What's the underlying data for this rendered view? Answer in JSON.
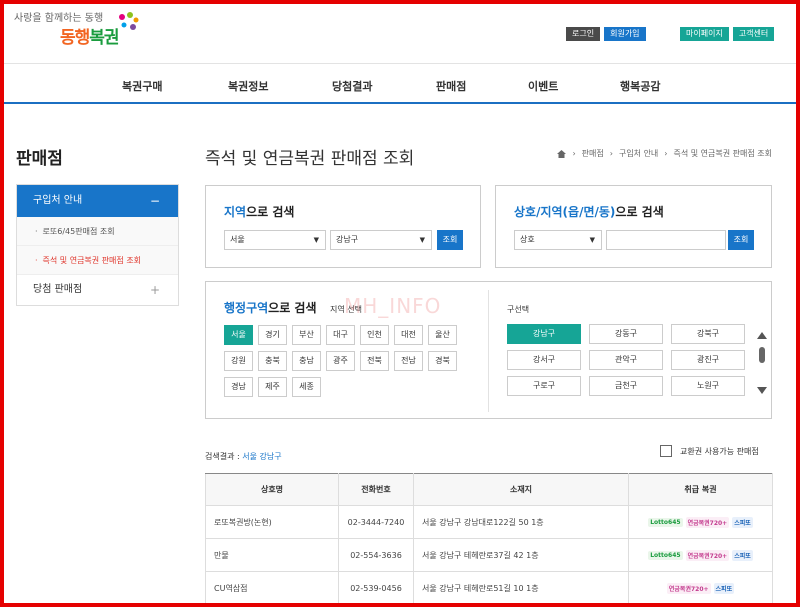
{
  "header": {
    "tagline": "사랑을 함께하는 동행",
    "brand_part1": "동행",
    "brand_part2": "복권",
    "util_left": [
      "로그인",
      "회원가입"
    ],
    "util_right": [
      "마이페이지",
      "고객센터"
    ]
  },
  "gnb": [
    "복권구매",
    "복권정보",
    "당첨결과",
    "판매점",
    "이벤트",
    "행복공감"
  ],
  "lnb": {
    "title": "판매점",
    "section_open": "구입처 안내",
    "open_symbol": "−",
    "closed_symbol": "+",
    "subs": [
      "로또6/45판매점 조회",
      "즉석 및 연금복권 판매점 조회"
    ],
    "section_closed": "당첨 판매점"
  },
  "page": {
    "title": "즉석 및 연금복권 판매점 조회",
    "breadcrumb": [
      "판매점",
      "구입처 안내",
      "즉석 및 연금복권 판매점 조회"
    ]
  },
  "region_search": {
    "title_hl": "지역",
    "title_rest": "으로 검색",
    "sido": "서울",
    "gugun": "강남구",
    "button": "조회"
  },
  "name_search": {
    "title_hl": "상호/지역(읍/면/동)",
    "title_rest": "으로 검색",
    "type": "상호",
    "value": "",
    "button": "조회"
  },
  "admin_search": {
    "title_hl": "행정구역",
    "title_rest": "으로 검색",
    "sub_label": "지역 선택",
    "regions": [
      "서울",
      "경기",
      "부산",
      "대구",
      "인천",
      "대전",
      "울산",
      "강원",
      "충북",
      "충남",
      "광주",
      "전북",
      "전남",
      "경북",
      "경남",
      "제주",
      "세종"
    ],
    "selected_region": "서울",
    "gu_label": "구선택",
    "districts": [
      "강남구",
      "강동구",
      "강북구",
      "강서구",
      "관악구",
      "광진구",
      "구로구",
      "금천구",
      "노원구"
    ],
    "selected_district": "강남구"
  },
  "watermark": "MH_INFO",
  "results": {
    "label": "검색결과 : ",
    "value": "서울 강남구",
    "exchange_label": "교환권 사용가능 판매점",
    "columns": [
      "상호명",
      "전화번호",
      "소재지",
      "취급 복권"
    ],
    "brand_names": {
      "lotto": "Lotto645",
      "pension": "연금복권720+",
      "speed": "스피또"
    },
    "rows": [
      {
        "name": "로또복권방(논현)",
        "phone": "02-3444-7240",
        "address": "서울 강남구 강남대로122길 50 1층",
        "brands": [
          "lotto",
          "pension",
          "speed"
        ]
      },
      {
        "name": "만물",
        "phone": "02-554-3636",
        "address": "서울 강남구 테헤란로37길 42 1층",
        "brands": [
          "lotto",
          "pension",
          "speed"
        ]
      },
      {
        "name": "CU역삼점",
        "phone": "02-539-0456",
        "address": "서울 강남구 테헤란로51길 10 1층",
        "brands": [
          "pension",
          "speed"
        ]
      }
    ]
  }
}
